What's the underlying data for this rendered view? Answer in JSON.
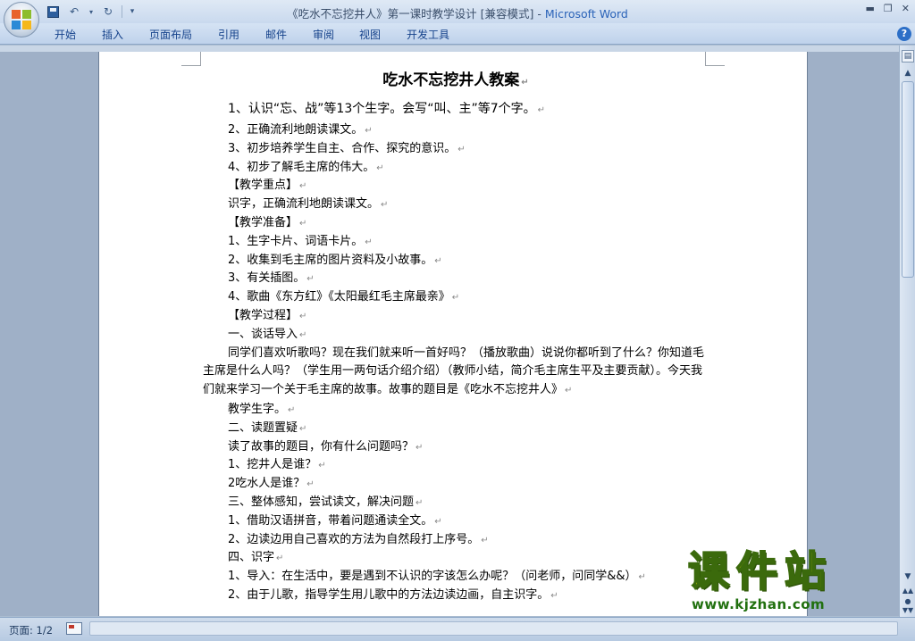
{
  "window": {
    "title_doc": "《吃水不忘挖井人》第一课时教学设计 [兼容模式] - ",
    "title_app": "Microsoft Word"
  },
  "ribbon": {
    "tabs": [
      "开始",
      "插入",
      "页面布局",
      "引用",
      "邮件",
      "审阅",
      "视图",
      "开发工具"
    ]
  },
  "document": {
    "heading": "吃水不忘挖井人教案",
    "objective_1": "1、认识“忘、战”等13个生字。会写“叫、主”等7个字。",
    "lines_a": [
      "2、正确流利地朗读课文。",
      "3、初步培养学生自主、合作、探究的意识。",
      "4、初步了解毛主席的伟大。",
      "【教学重点】",
      "识字，正确流利地朗读课文。",
      "【教学准备】",
      "1、生字卡片、词语卡片。",
      "2、收集到毛主席的图片资料及小故事。",
      "3、有关插图。",
      "4、歌曲《东方红》《太阳最红毛主席最亲》",
      "【教学过程】",
      "一、谈话导入"
    ],
    "paragraph": "同学们喜欢听歌吗？现在我们就来听一首好吗？（播放歌曲）说说你都听到了什么？你知道毛主席是什么人吗？（学生用一两句话介绍介绍）（教师小结，简介毛主席生平及主要贡献）。今天我们就来学习一个关于毛主席的故事。故事的题目是《吃水不忘挖井人》",
    "lines_b": [
      "教学生字。",
      "二、读题置疑",
      "读了故事的题目，你有什么问题吗？",
      "1、挖井人是谁？",
      "2吃水人是谁？",
      "三、整体感知，尝试读文，解决问题",
      "1、借助汉语拼音，带着问题通读全文。",
      "2、边读边用自己喜欢的方法为自然段打上序号。",
      "四、识字",
      "1、导入：在生活中，要是遇到不认识的字该怎么办呢？（问老师，问同学&&）",
      "2、由于儿歌，指导学生用儿歌中的方法边读边画，自主识字。"
    ],
    "paragraph_mark": "↵"
  },
  "statusbar": {
    "page_label": "页面: 1/2"
  },
  "watermark": {
    "main": "课件站",
    "url": "www.kjzhan.com"
  }
}
